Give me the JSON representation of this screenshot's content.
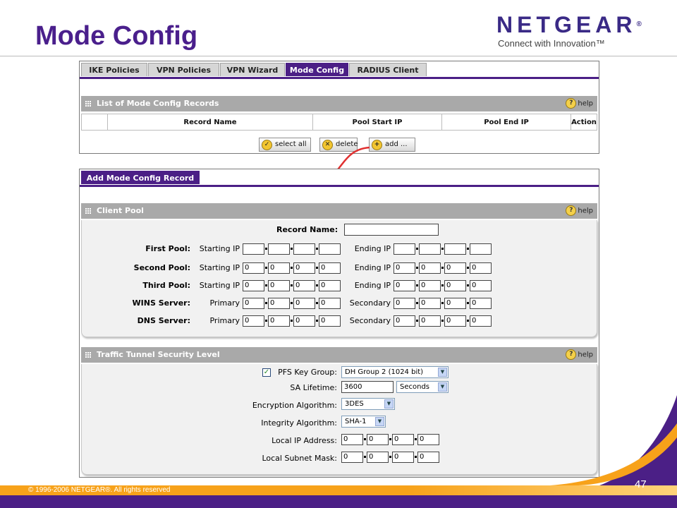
{
  "slide": {
    "title": "Mode Config",
    "logo_word": "NETGEAR",
    "logo_reg": "®",
    "logo_tagline": "Connect with Innovation™",
    "copyright": "© 1996-2006 NETGEAR®. All rights reserved",
    "page_number": "47"
  },
  "colors": {
    "brand_purple": "#4b1f86",
    "header_gray": "#a9a9a9",
    "footer_orange": "#f7a21a"
  },
  "tabs": [
    {
      "label": "IKE Policies",
      "active": false
    },
    {
      "label": "VPN Policies",
      "active": false
    },
    {
      "label": "VPN Wizard",
      "active": false
    },
    {
      "label": "Mode Config",
      "active": true
    },
    {
      "label": "RADIUS Client",
      "active": false
    }
  ],
  "list_section": {
    "title": "List of Mode Config Records",
    "help": "help",
    "columns": [
      "",
      "Record Name",
      "Pool Start IP",
      "Pool End IP",
      "Action"
    ],
    "buttons": {
      "select_all": "select all",
      "delete": "delete",
      "add": "add ..."
    }
  },
  "add_tab": {
    "label": "Add Mode Config Record"
  },
  "client_pool": {
    "title": "Client Pool",
    "help": "help",
    "record_name_label": "Record Name:",
    "record_name_value": "",
    "rows": [
      {
        "label": "First Pool:",
        "left_label": "Starting IP",
        "right_label": "Ending IP",
        "left": [
          "",
          "",
          "",
          ""
        ],
        "right": [
          "",
          "",
          "",
          ""
        ]
      },
      {
        "label": "Second Pool:",
        "left_label": "Starting IP",
        "right_label": "Ending IP",
        "left": [
          "0",
          "0",
          "0",
          "0"
        ],
        "right": [
          "0",
          "0",
          "0",
          "0"
        ]
      },
      {
        "label": "Third Pool:",
        "left_label": "Starting IP",
        "right_label": "Ending IP",
        "left": [
          "0",
          "0",
          "0",
          "0"
        ],
        "right": [
          "0",
          "0",
          "0",
          "0"
        ]
      },
      {
        "label": "WINS Server:",
        "left_label": "Primary",
        "right_label": "Secondary",
        "left": [
          "0",
          "0",
          "0",
          "0"
        ],
        "right": [
          "0",
          "0",
          "0",
          "0"
        ]
      },
      {
        "label": "DNS Server:",
        "left_label": "Primary",
        "right_label": "Secondary",
        "left": [
          "0",
          "0",
          "0",
          "0"
        ],
        "right": [
          "0",
          "0",
          "0",
          "0"
        ]
      }
    ]
  },
  "traffic": {
    "title": "Traffic Tunnel Security Level",
    "help": "help",
    "pfs_label": "PFS Key Group:",
    "pfs_checked": true,
    "pfs_value": "DH Group 2 (1024 bit)",
    "sa_label": "SA Lifetime:",
    "sa_value": "3600",
    "sa_unit": "Seconds",
    "enc_label": "Encryption Algorithm:",
    "enc_value": "3DES",
    "int_label": "Integrity Algorithm:",
    "int_value": "SHA-1",
    "local_ip_label": "Local IP Address:",
    "local_ip": [
      "0",
      "0",
      "0",
      "0"
    ],
    "local_mask_label": "Local Subnet Mask:",
    "local_mask": [
      "0",
      "0",
      "0",
      "0"
    ]
  }
}
